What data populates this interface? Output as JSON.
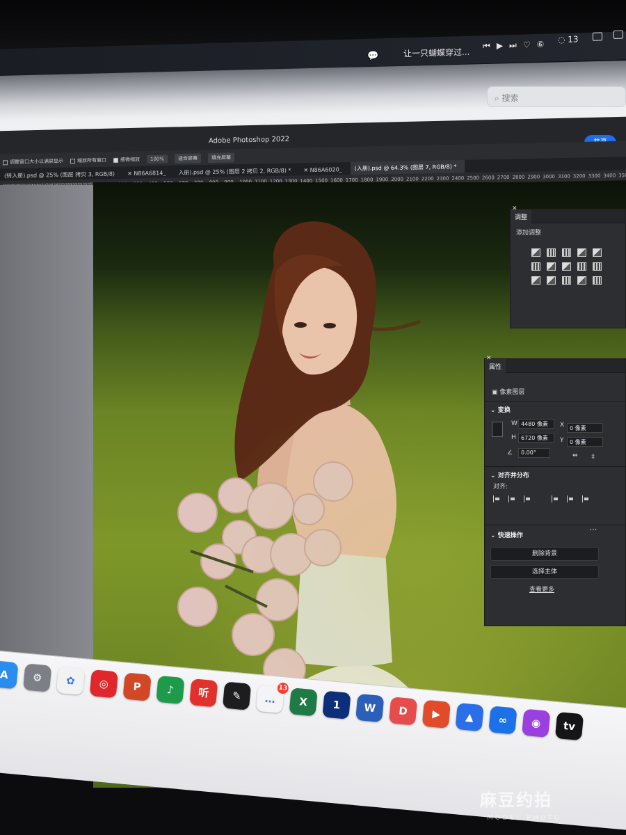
{
  "menubar": {
    "wechat_icon": "wechat-icon",
    "now_playing": "让一只蝴蝶穿过...",
    "media_controls": [
      "⏮",
      "▶",
      "⏭",
      "♡",
      "⑥"
    ],
    "notification_count": "13"
  },
  "browser": {
    "search_placeholder": "搜索"
  },
  "photoshop": {
    "title": "Adobe Photoshop 2022",
    "share_label": "共享",
    "options": {
      "resize_windows": "调整窗口大小以满屏显示",
      "zoom_all": "缩放所有窗口",
      "scrubby_zoom": "细微缩放",
      "zoom_100": "100%",
      "fit_screen": "适合屏幕",
      "fill_screen": "填充屏幕"
    },
    "tabs": [
      "(转入册).psd @ 25% (图层 拷贝 3, RGB/8)",
      "N86A6814_",
      "入册).psd @ 25% (图层 2 拷贝 2, RGB/8) *",
      "N86A6020_",
      "(入册).psd @ 64.3% (图层 7, RGB/8) *"
    ],
    "ruler_left": [
      "950",
      "900",
      "850",
      "800",
      "750",
      "700",
      "650",
      "600",
      "550",
      "500",
      "450",
      "400",
      "350",
      "300",
      "250",
      "200",
      "150",
      "100",
      "50",
      "0"
    ],
    "ruler_right": [
      "100",
      "200",
      "300",
      "400",
      "500",
      "600",
      "700",
      "800",
      "900",
      "1000",
      "1100",
      "1200",
      "1300",
      "1400",
      "1500",
      "1600",
      "1700",
      "1800",
      "1900",
      "2000",
      "2100",
      "2200",
      "2300",
      "2400",
      "2500",
      "2600",
      "2700",
      "2800",
      "2900",
      "3000",
      "3100",
      "3200",
      "3300",
      "3400",
      "3500"
    ]
  },
  "adjust_panel": {
    "tab": "调整",
    "subtitle": "添加调整"
  },
  "properties_panel": {
    "tab": "属性",
    "layer_type": "像素图层",
    "transform_title": "变换",
    "w_label": "W",
    "w_value": "4480 像素",
    "h_label": "H",
    "h_value": "6720 像素",
    "x_label": "X",
    "x_value": "0 像素",
    "y_label": "Y",
    "y_value": "0 像素",
    "angle_value": "0.00°",
    "align_title": "对齐并分布",
    "align_label": "对齐:",
    "quick_title": "快速操作",
    "remove_bg": "删除背景",
    "select_subject": "选择主体",
    "see_more": "查看更多"
  },
  "dock": {
    "apps": [
      {
        "name": "app-store-icon",
        "color": "#2b8cf0",
        "glyph": "A"
      },
      {
        "name": "system-settings-icon",
        "color": "#7d7f86",
        "glyph": "⚙"
      },
      {
        "name": "photos-icon",
        "color": "#f2f2f2",
        "glyph": "✿"
      },
      {
        "name": "netease-music-icon",
        "color": "#e0272c",
        "glyph": "◎"
      },
      {
        "name": "powerpoint-icon",
        "color": "#d24726",
        "glyph": "P"
      },
      {
        "name": "music-app-icon",
        "color": "#1e9b4a",
        "glyph": "♪"
      },
      {
        "name": "ting-icon",
        "color": "#e2312c",
        "glyph": "听"
      },
      {
        "name": "notes-app-icon",
        "color": "#1d1d1f",
        "glyph": "✎"
      },
      {
        "name": "messages-icon",
        "color": "#f4f4f6",
        "glyph": "…",
        "badge": "13"
      },
      {
        "name": "excel-icon",
        "color": "#1f7a45",
        "glyph": "X"
      },
      {
        "name": "one-app-icon",
        "color": "#0d2f7a",
        "glyph": "1"
      },
      {
        "name": "word-icon",
        "color": "#2b5fb8",
        "glyph": "W"
      },
      {
        "name": "pdf-app-icon",
        "color": "#e64c4c",
        "glyph": "D"
      },
      {
        "name": "kuaishou-icon",
        "color": "#e24b2a",
        "glyph": "▶"
      },
      {
        "name": "lark-icon",
        "color": "#2a6ee8",
        "glyph": "▲"
      },
      {
        "name": "link-app-icon",
        "color": "#1d71e8",
        "glyph": "∞"
      },
      {
        "name": "podcasts-icon",
        "color": "#9a3fe0",
        "glyph": "◉"
      },
      {
        "name": "apple-tv-icon",
        "color": "#151517",
        "glyph": "tv"
      }
    ]
  },
  "watermark": {
    "cn": "麻豆约拍",
    "en": "MODEL PHOTO"
  }
}
